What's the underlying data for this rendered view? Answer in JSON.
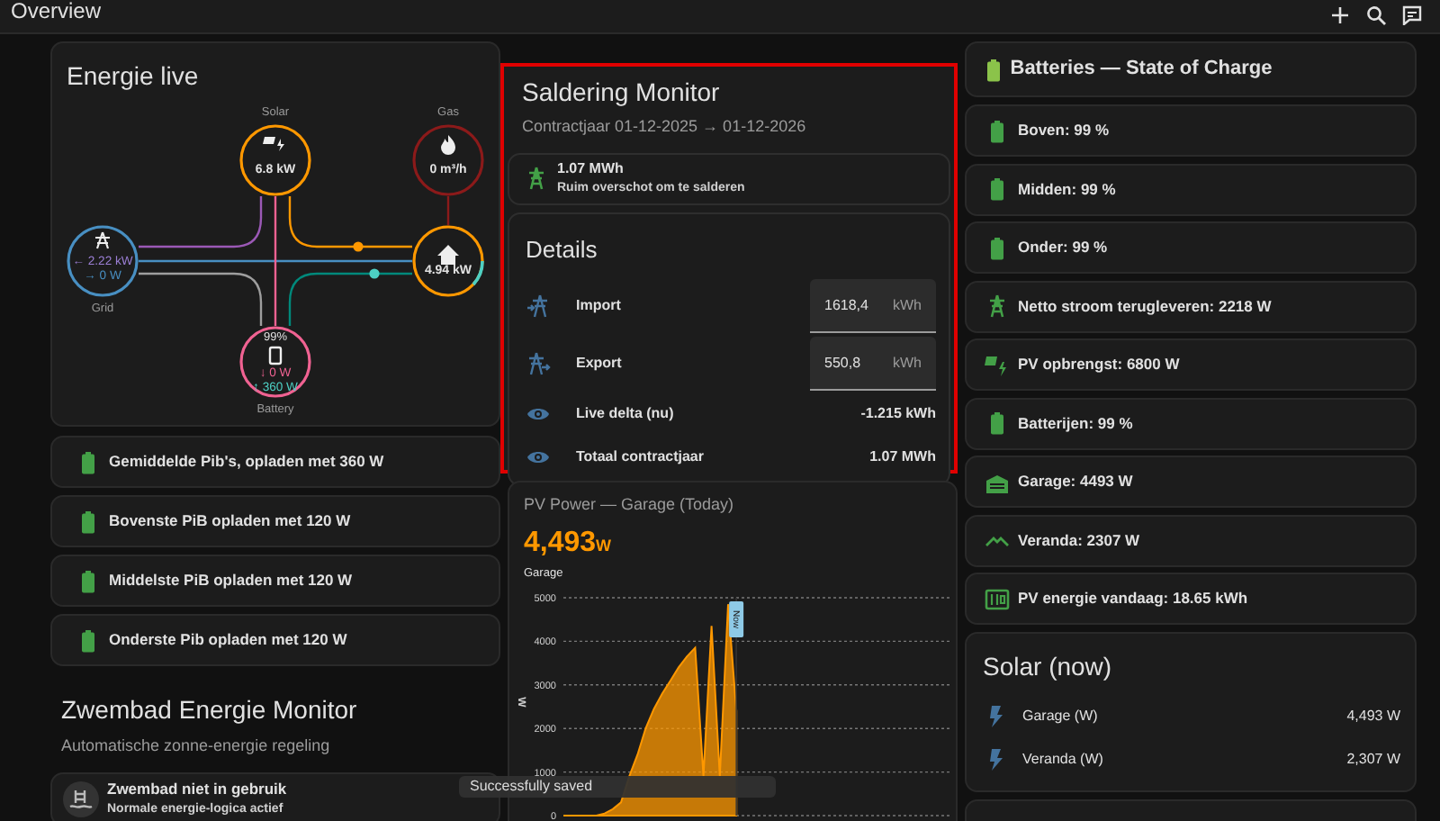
{
  "header": {
    "title": "Overview"
  },
  "energy_flow": {
    "title": "Energie live",
    "nodes": [
      {
        "kind": "solar",
        "label": "Solar",
        "value": "6.8 kW"
      },
      {
        "kind": "gas",
        "label": "Gas",
        "value": "0 m³/h"
      },
      {
        "kind": "grid",
        "label": "Grid",
        "values": [
          "← 2.22 kW",
          "→ 0 W"
        ]
      },
      {
        "kind": "home",
        "value": "4.94 kW"
      },
      {
        "kind": "battery",
        "label": "Battery",
        "charge": "99%",
        "values": [
          "↓ 0 W",
          "↑ 360 W"
        ]
      }
    ]
  },
  "pib_rows": [
    "Gemiddelde Pib's, opladen met 360 W",
    "Bovenste PiB opladen met 120 W",
    "Middelste PiB opladen met 120 W",
    "Onderste Pib opladen met 120 W"
  ],
  "zwembad": {
    "title": "Zwembad Energie Monitor",
    "subtitle": "Automatische zonne-energie regeling",
    "status": {
      "title": "Zwembad niet in gebruik",
      "subtitle": "Normale energie-logica actief"
    }
  },
  "saldering": {
    "title": "Saldering Monitor",
    "subtitle": "Contractjaar 01-12-2025 → 01-12-2026",
    "summary": {
      "value": "1.07 MWh",
      "text": "Ruim overschot om te salderen"
    },
    "details": {
      "title": "Details",
      "rows": [
        {
          "kind": "import",
          "label": "Import",
          "value": "1618,4",
          "unit": "kWh"
        },
        {
          "kind": "export",
          "label": "Export",
          "value": "550,8",
          "unit": "kWh"
        },
        {
          "kind": "reading",
          "label": "Live delta (nu)",
          "value": "-1.215 kWh"
        },
        {
          "kind": "reading",
          "label": "Totaal contractjaar",
          "value": "1.07 MWh"
        }
      ]
    }
  },
  "pv_chart": {
    "title": "PV Power — Garage (Today)",
    "value": "4,493",
    "unit": "W",
    "chart_data": {
      "type": "area",
      "ylabel": "W",
      "ylim": [
        0,
        5000
      ],
      "grid": true,
      "yticks": [
        0,
        1000,
        2000,
        3000,
        4000,
        5000
      ],
      "annotations": [
        {
          "text": "Now"
        }
      ],
      "series": [
        {
          "name": "Garage",
          "color": "#ff9800",
          "values": [
            0,
            0,
            0,
            0,
            0,
            50,
            150,
            300,
            900,
            1400,
            2000,
            2450,
            2800,
            3100,
            3400,
            3650,
            3850,
            900,
            4350,
            900,
            4850,
            2400,
            null,
            null,
            null,
            null,
            null,
            null,
            null,
            null,
            null,
            null,
            null,
            null,
            null,
            null,
            null,
            null,
            null,
            null,
            null,
            null,
            null,
            null,
            null,
            null,
            null,
            null
          ]
        }
      ]
    }
  },
  "batteries": {
    "title": "Batteries — State of Charge",
    "rows": [
      {
        "kind": "battery",
        "text": "Boven: 99 %"
      },
      {
        "kind": "battery",
        "text": "Midden: 99 %"
      },
      {
        "kind": "battery",
        "text": "Onder: 99 %"
      },
      {
        "kind": "tower",
        "text": "Netto stroom terugleveren: 2218 W"
      },
      {
        "kind": "solar",
        "text": "PV opbrengst: 6800 W"
      },
      {
        "kind": "battery",
        "text": "Batterijen: 99 %"
      },
      {
        "kind": "garage",
        "text": "Garage: 4493 W"
      },
      {
        "kind": "roof",
        "text": "Veranda: 2307 W"
      },
      {
        "kind": "meter",
        "text": "PV energie vandaag: 18.65 kWh"
      }
    ]
  },
  "solar_now": {
    "title": "Solar (now)",
    "rows": [
      {
        "label": "Garage (W)",
        "value": "4,493 W"
      },
      {
        "label": "Veranda (W)",
        "value": "2,307 W"
      }
    ]
  },
  "toast": {
    "text": "Successfully saved"
  }
}
